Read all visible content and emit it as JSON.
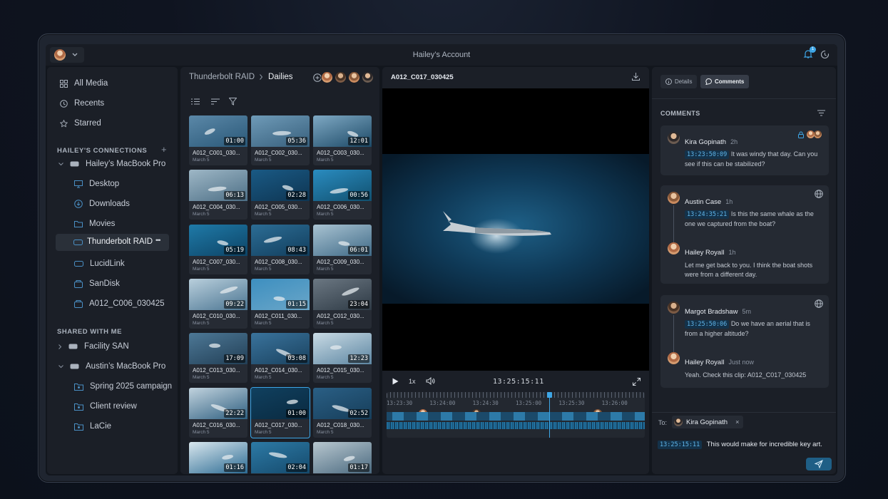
{
  "window": {
    "title": "Hailey’s Account",
    "notification_count": "1"
  },
  "sidebar": {
    "top_items": [
      {
        "label": "All Media",
        "icon": "grid-icon"
      },
      {
        "label": "Recents",
        "icon": "clock-icon"
      },
      {
        "label": "Starred",
        "icon": "star-icon"
      }
    ],
    "connections_header": "HAILEY'S CONNECTIONS",
    "connections": [
      {
        "label": "Hailey’s MacBook Pro",
        "icon": "drive-icon",
        "level": 0,
        "expanded": true
      },
      {
        "label": "Desktop",
        "icon": "monitor-icon",
        "level": 1
      },
      {
        "label": "Downloads",
        "icon": "download-icon",
        "level": 1
      },
      {
        "label": "Movies",
        "icon": "folder-icon",
        "level": 1
      },
      {
        "label": "Thunderbolt RAID",
        "icon": "drive-icon",
        "level": 1,
        "selected": true
      },
      {
        "label": "LucidLink",
        "icon": "drive-icon",
        "level": 1
      },
      {
        "label": "SanDisk",
        "icon": "external-drive-icon",
        "level": 1
      },
      {
        "label": "A012_C006_030425",
        "icon": "external-drive-icon",
        "level": 1
      }
    ],
    "more_label": "•••",
    "shared_header": "SHARED WITH ME",
    "shared": [
      {
        "label": "Facility SAN",
        "icon": "drive-icon",
        "level": 0,
        "expanded": false
      },
      {
        "label": "Austin’s MacBook Pro",
        "icon": "drive-icon",
        "level": 0,
        "expanded": true
      },
      {
        "label": "Spring 2025 campaign",
        "icon": "shared-folder-icon",
        "level": 1
      },
      {
        "label": "Client review",
        "icon": "shared-folder-icon",
        "level": 1
      },
      {
        "label": "LaCie",
        "icon": "shared-folder-icon",
        "level": 1
      }
    ]
  },
  "browser": {
    "breadcrumb_parent": "Thunderbolt RAID",
    "breadcrumb_current": "Dailies",
    "clips": [
      {
        "name": "A012_C001_030...",
        "date": "March 5",
        "duration": "01:00"
      },
      {
        "name": "A012_C002_030...",
        "date": "March 5",
        "duration": "05:36"
      },
      {
        "name": "A012_C003_030...",
        "date": "March 5",
        "duration": "12:01"
      },
      {
        "name": "A012_C004_030...",
        "date": "March 5",
        "duration": "06:13"
      },
      {
        "name": "A012_C005_030...",
        "date": "March 5",
        "duration": "02:28"
      },
      {
        "name": "A012_C006_030...",
        "date": "March 5",
        "duration": "00:56"
      },
      {
        "name": "A012_C007_030...",
        "date": "March 5",
        "duration": "05:19"
      },
      {
        "name": "A012_C008_030...",
        "date": "March 5",
        "duration": "08:43"
      },
      {
        "name": "A012_C009_030...",
        "date": "March 5",
        "duration": "06:01"
      },
      {
        "name": "A012_C010_030...",
        "date": "March 5",
        "duration": "09:22"
      },
      {
        "name": "A012_C011_030...",
        "date": "March 5",
        "duration": "01:15"
      },
      {
        "name": "A012_C012_030...",
        "date": "March 5",
        "duration": "23:04"
      },
      {
        "name": "A012_C013_030...",
        "date": "March 5",
        "duration": "17:09"
      },
      {
        "name": "A012_C014_030...",
        "date": "March 5",
        "duration": "03:08"
      },
      {
        "name": "A012_C015_030...",
        "date": "March 5",
        "duration": "12:23"
      },
      {
        "name": "A012_C016_030...",
        "date": "March 5",
        "duration": "22:22"
      },
      {
        "name": "A012_C017_030...",
        "date": "March 5",
        "duration": "01:00",
        "selected": true
      },
      {
        "name": "A012_C018_030...",
        "date": "March 5",
        "duration": "02:52"
      },
      {
        "name": "",
        "date": "",
        "duration": "01:16"
      },
      {
        "name": "",
        "date": "",
        "duration": "02:04"
      },
      {
        "name": "",
        "date": "",
        "duration": "01:17"
      }
    ]
  },
  "player": {
    "clip_title": "A012_C017_030425",
    "speed": "1x",
    "timecode": "13:25:15:11",
    "ruler_labels": [
      "13:23:30",
      "13:24:00",
      "13:24:30",
      "13:25:00",
      "13:25:30",
      "13:26:00"
    ],
    "playhead_fraction": 0.63
  },
  "comments": {
    "tab_details": "Details",
    "tab_comments": "Comments",
    "header": "COMMENTS",
    "threads": [
      {
        "author": "Kira Gopinath",
        "time": "2h",
        "timecode": "13:23:50:09",
        "text": "It was windy that day. Can you see if this can be stabilized?"
      },
      {
        "author": "Austin Case",
        "time": "1h",
        "timecode": "13:24:35:21",
        "text": "Is this the same whale as the one we captured from the boat?",
        "reply": {
          "author": "Hailey Royall",
          "time": "1h",
          "text": "Let me get back to you. I think the boat shots were from a different day."
        }
      },
      {
        "author": "Margot Bradshaw",
        "time": "5m",
        "timecode": "13:25:50:06",
        "text": "Do we have an aerial that is from a higher altitude?",
        "reply": {
          "author": "Hailey Royall",
          "time": "Just now",
          "text": "Yeah. Check this clip: A012_C017_030425"
        }
      }
    ],
    "to_label": "To:",
    "recipient": "Kira Gopinath",
    "draft_timecode": "13:25:15:11",
    "draft_text": "This would make for incredible key art."
  },
  "colors": {
    "accent": "#3ea6e6",
    "panel": "#1b1f27",
    "card": "#252a33"
  }
}
